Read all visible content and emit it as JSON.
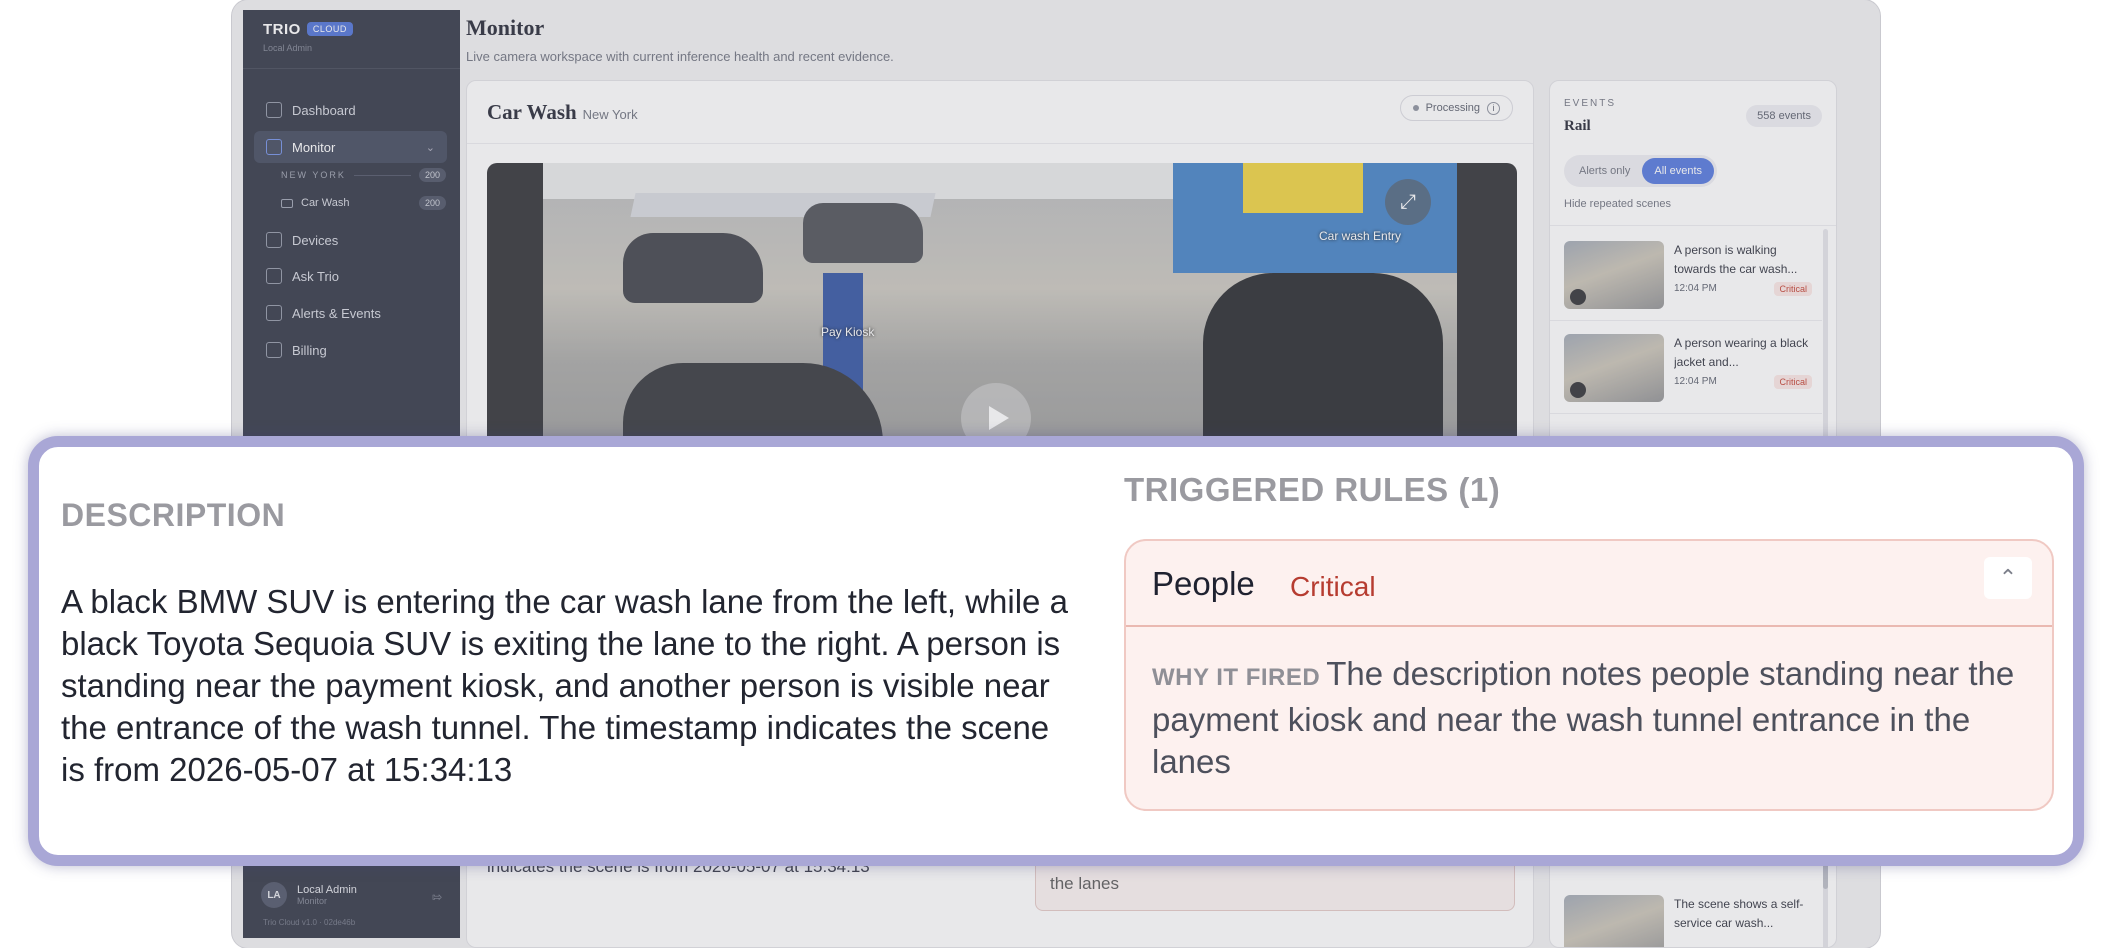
{
  "sidebar": {
    "brand": "TRIO",
    "brand_badge": "CLOUD",
    "brand_sub": "Local Admin",
    "nav": [
      {
        "label": "Dashboard",
        "icon": "dashboard-icon"
      },
      {
        "label": "Monitor",
        "icon": "camera-icon",
        "active": true
      },
      {
        "label": "Devices",
        "icon": "devices-icon"
      },
      {
        "label": "Ask Trio",
        "icon": "chat-icon"
      },
      {
        "label": "Alerts & Events",
        "icon": "bell-icon"
      },
      {
        "label": "Billing",
        "icon": "card-icon"
      }
    ],
    "group_label": "NEW YORK",
    "group_count": "200",
    "camera_label": "Car Wash",
    "camera_count": "200",
    "user_initials": "LA",
    "user_name": "Local Admin",
    "user_role": "Monitor",
    "version": "Trio Cloud v1.0 · 02de46b"
  },
  "main": {
    "title": "Monitor",
    "subtitle": "Live camera workspace with current inference health and recent evidence.",
    "camera_title": "Car Wash",
    "camera_city": "New York",
    "status": "Processing",
    "video_labels": {
      "entry": "Car wash Entry",
      "kiosk": "Pay Kiosk"
    },
    "bg_desc": "indicates the scene is from 2026-05-07 at 15:34:13",
    "bg_rule": "the lanes"
  },
  "rail": {
    "kicker": "EVENTS",
    "title": "Rail",
    "count": "558 events",
    "filter_alerts": "Alerts only",
    "filter_all": "All events",
    "hide_repeated": "Hide repeated scenes",
    "events": [
      {
        "text": "A person is walking towards the car wash...",
        "time": "12:04 PM",
        "severity": "Critical"
      },
      {
        "text": "A person wearing a black jacket and...",
        "time": "12:04 PM",
        "severity": "Critical"
      },
      {
        "text": "The scene shows a self-service car wash...",
        "time": "",
        "severity": ""
      }
    ]
  },
  "zoom": {
    "description_heading": "DESCRIPTION",
    "description": "A black BMW SUV is entering the car wash lane from the left, while a black Toyota Sequoia SUV is exiting the lane to the right. A person is standing near the payment kiosk, and another person is visible near the entrance of the wash tunnel. The timestamp indicates the scene is from 2026-05-07 at 15:34:13",
    "rules_heading": "TRIGGERED RULES (1)",
    "rule_name": "People",
    "rule_severity": "Critical",
    "why_label": "WHY IT FIRED",
    "why_text": "The description notes people standing near the payment kiosk and near the wash tunnel entrance in the lanes"
  },
  "colors": {
    "accent": "#4f74dd",
    "critical": "#b63c30",
    "sidebar": "#2c3140",
    "zoom_border": "#a9a7d6"
  }
}
